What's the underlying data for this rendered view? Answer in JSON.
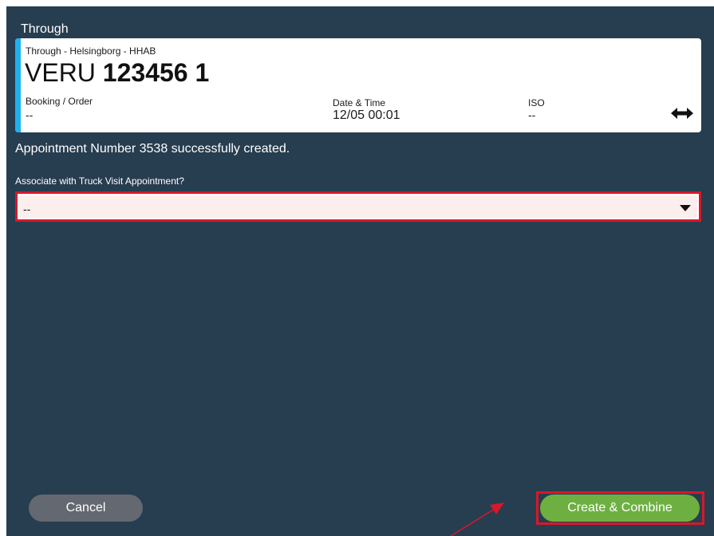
{
  "dialog": {
    "title": "Through"
  },
  "card": {
    "route": "Through - Helsingborg - HHAB",
    "container_prefix": "VERU",
    "container_number": "123456 1",
    "fields": {
      "booking_label": "Booking / Order",
      "booking_value": "--",
      "datetime_label": "Date & Time",
      "datetime_value": "12/05 00:01",
      "iso_label": "ISO",
      "iso_value": "--"
    },
    "swap_icon": "swap-horizontal-icon",
    "accent_color": "#1fb0ef"
  },
  "message": "Appointment Number 3538 successfully created.",
  "associate": {
    "label": "Associate with Truck Visit Appointment?",
    "selected": "--",
    "icon": "caret-down-icon"
  },
  "buttons": {
    "cancel": "Cancel",
    "create_combine": "Create & Combine"
  },
  "colors": {
    "background": "#273d50",
    "highlight": "#d7182a",
    "primary": "#6db041",
    "secondary": "#646870"
  }
}
